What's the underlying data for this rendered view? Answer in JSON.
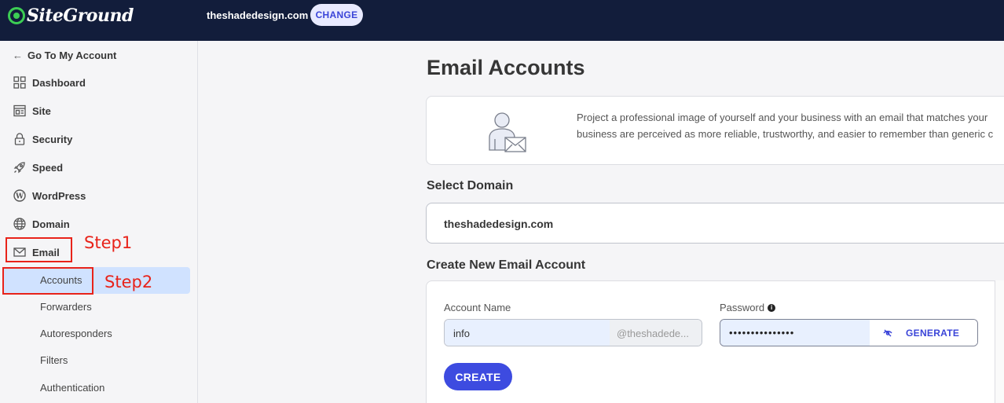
{
  "topbar": {
    "logo_text": "SiteGround",
    "site_domain": "theshadedesign.com",
    "change_label": "CHANGE",
    "logo_color": "#3ccd54"
  },
  "sidebar": {
    "back_label": "Go To My Account",
    "items": [
      {
        "label": "Dashboard",
        "icon": "dashboard-icon"
      },
      {
        "label": "Site",
        "icon": "site-icon"
      },
      {
        "label": "Security",
        "icon": "lock-icon"
      },
      {
        "label": "Speed",
        "icon": "rocket-icon"
      },
      {
        "label": "WordPress",
        "icon": "wordpress-icon"
      },
      {
        "label": "Domain",
        "icon": "globe-icon"
      },
      {
        "label": "Email",
        "icon": "envelope-icon"
      }
    ],
    "email_subitems": [
      "Accounts",
      "Forwarders",
      "Autoresponders",
      "Filters",
      "Authentication"
    ],
    "active_subitem": "Accounts"
  },
  "annotations": {
    "step1": "Step1",
    "step2": "Step2",
    "color": "#e8231a"
  },
  "main": {
    "title": "Email Accounts",
    "intro_line1": "Project a professional image of yourself and your business with an email that matches your",
    "intro_line2": "business are perceived as more reliable, trustworthy, and easier to remember than generic c",
    "select_domain_title": "Select Domain",
    "selected_domain": "theshadedesign.com",
    "create_title": "Create New Email Account",
    "account_name_label": "Account Name",
    "account_name_value": "info",
    "account_suffix": "@theshadede...",
    "password_label": "Password",
    "password_value": "•••••••••••••••",
    "generate_label": "GENERATE",
    "create_label": "CREATE",
    "accent_color": "#3d4be0"
  }
}
